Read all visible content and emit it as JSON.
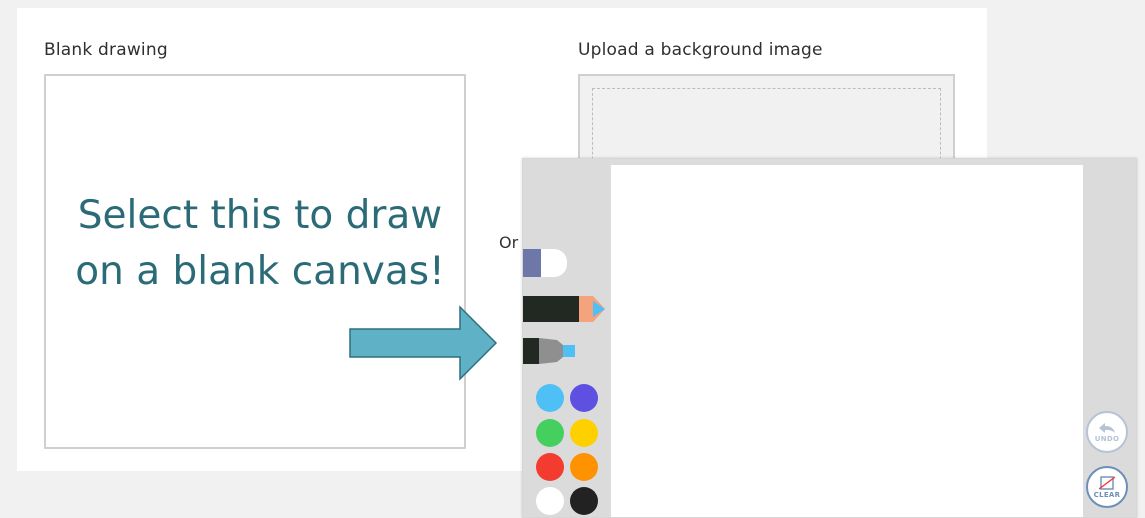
{
  "sections": {
    "blank_label": "Blank drawing",
    "upload_label": "Upload a background image",
    "or_label": "Or"
  },
  "callout": {
    "line1": "Select this to draw",
    "line2": "on a blank canvas!"
  },
  "drawing_tools": {
    "tools": [
      "eraser",
      "pencil",
      "marker"
    ],
    "colors": [
      [
        "#4fc0f5",
        "#5e50e0"
      ],
      [
        "#45cf5f",
        "#ffd000"
      ],
      [
        "#f43b30",
        "#ff9200"
      ],
      [
        "#ffffff",
        "#222222"
      ]
    ],
    "undo_label": "UNDO",
    "clear_label": "CLEAR"
  }
}
